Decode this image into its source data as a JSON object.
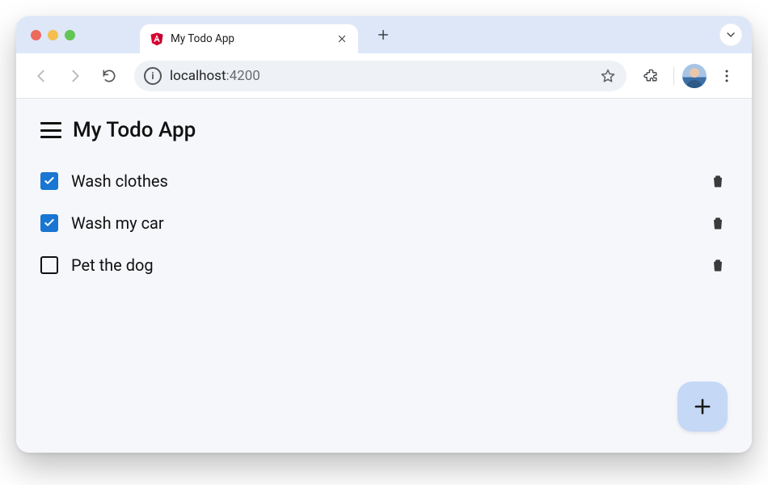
{
  "browser": {
    "tab": {
      "title": "My Todo App"
    },
    "url": {
      "host": "localhost",
      "port": ":4200"
    }
  },
  "app": {
    "title": "My Todo App",
    "todos": [
      {
        "label": "Wash clothes",
        "done": true
      },
      {
        "label": "Wash my car",
        "done": true
      },
      {
        "label": "Pet the dog",
        "done": false
      }
    ]
  },
  "colors": {
    "accent": "#1976d2",
    "tabstrip": "#dde7f8",
    "content_bg": "#f6f7fb",
    "fab_bg": "#c5d8f6"
  }
}
